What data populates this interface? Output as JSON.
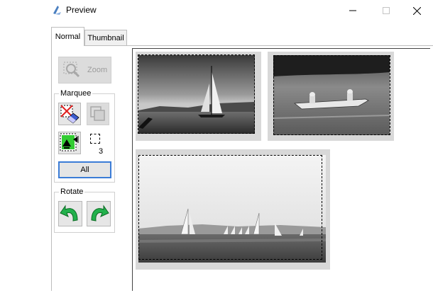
{
  "window": {
    "title": "Preview",
    "minimize_icon": "minimize-icon",
    "maximize_icon": "maximize-icon",
    "close_icon": "close-icon"
  },
  "tabs": [
    {
      "label": "Normal",
      "active": true
    },
    {
      "label": "Thumbnail",
      "active": false
    }
  ],
  "toolbar": {
    "zoom_label": "Zoom",
    "marquee_group_label": "Marquee",
    "marquee_count": "3",
    "all_label": "All",
    "rotate_group_label": "Rotate"
  },
  "colors": {
    "accent": "#3b7cd6",
    "rotate_arrow": "#22b14c",
    "photo_frame": "#d8d8d8"
  },
  "preview": {
    "photo_count": 3,
    "photos": [
      "sailboat-photo",
      "canoe-photo",
      "regatta-photo"
    ]
  }
}
